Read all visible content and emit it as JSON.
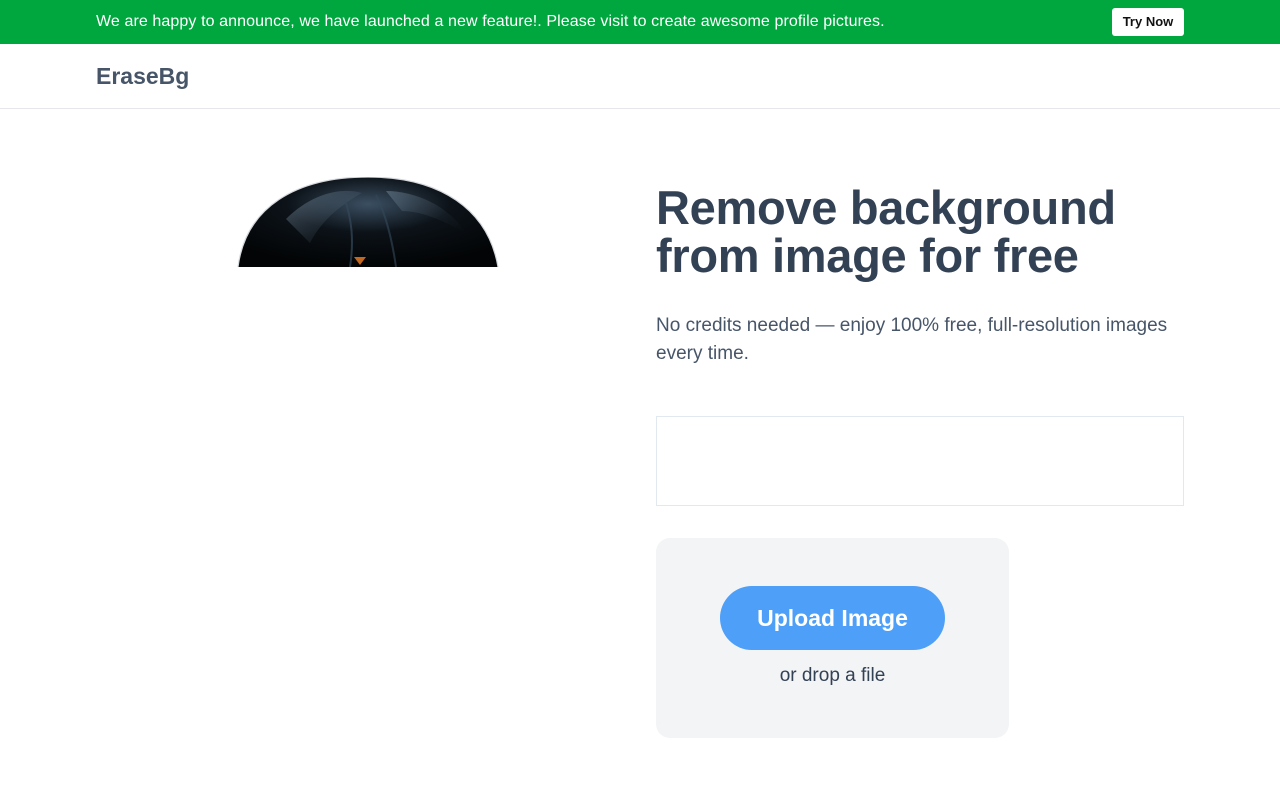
{
  "banner": {
    "text": "We are happy to announce, we have launched a new feature!. Please visit to create awesome profile pictures.",
    "button_label": "Try Now",
    "background_color": "#00a73e"
  },
  "header": {
    "logo": "EraseBg"
  },
  "hero": {
    "headline": "Remove background from image for free",
    "subtext": "No credits needed — enjoy 100% free, full-resolution images every time.",
    "image_icon": "person-hair-image"
  },
  "upload": {
    "button_label": "Upload Image",
    "drop_text": "or drop a file",
    "button_color": "#4d9ff7"
  }
}
